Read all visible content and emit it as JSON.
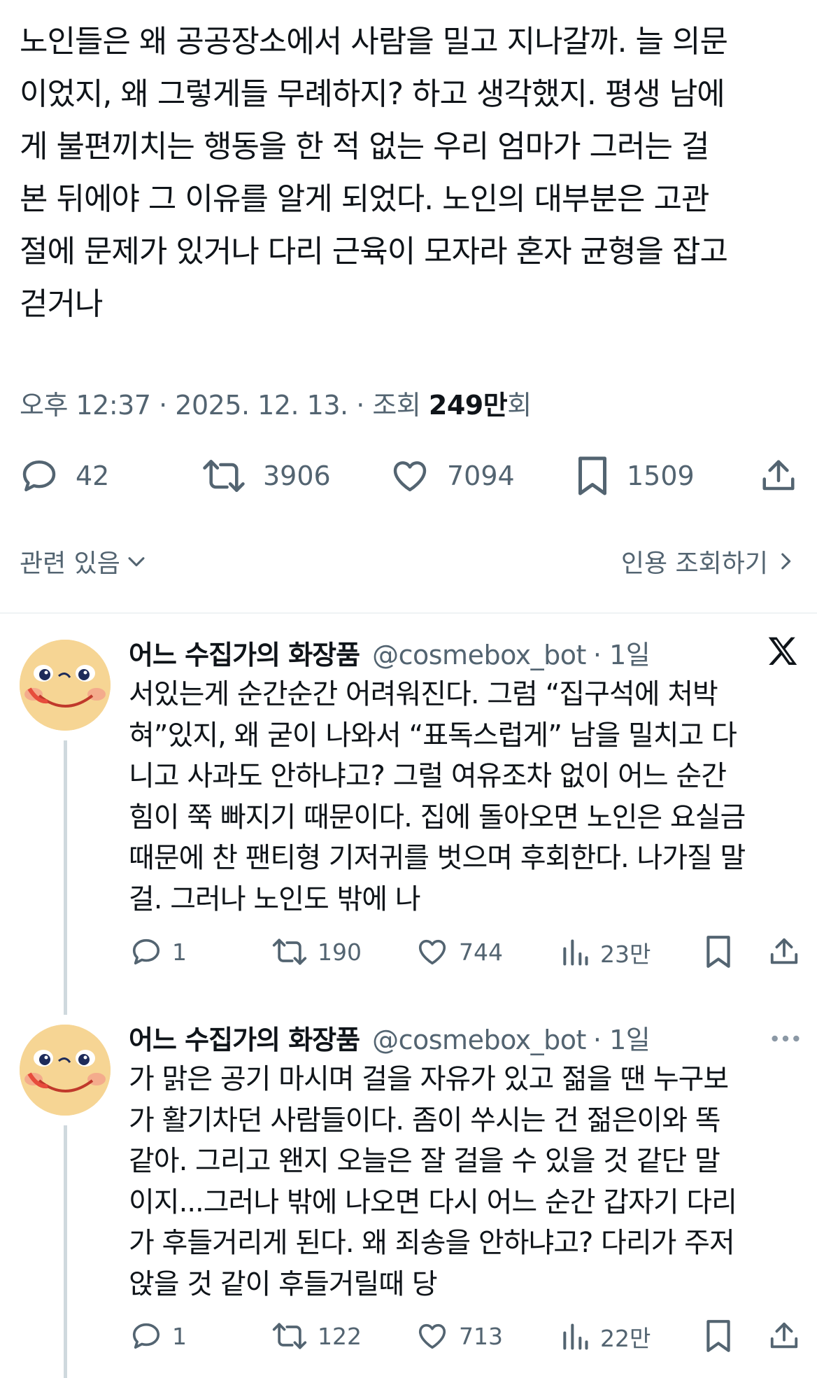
{
  "tweet": {
    "text": "노인들은 왜 공공장소에서 사람을 밀고 지나갈까. 늘 의문\n이었지, 왜 그렇게들 무례하지? 하고 생각했지. 평생 남에\n게 불편끼치는 행동을 한 적 없는 우리 엄마가 그러는 걸\n본 뒤에야 그 이유를 알게 되었다. 노인의 대부분은 고관\n절에 문제가 있거나 다리 근육이 모자라 혼자 균형을 잡고\n걷거나",
    "time": "오후 12:37",
    "date": "2025. 12. 13.",
    "views_label": "조회",
    "views_value": "249만",
    "views_suffix": "회",
    "separator": "·",
    "replies": "42",
    "retweets": "3906",
    "likes": "7094",
    "bookmarks": "1509"
  },
  "related": {
    "label": "관련 있음",
    "quote_label": "인용 조회하기"
  },
  "replies": [
    {
      "name": "어느 수집가의 화장품",
      "handle": "@cosmebox_bot",
      "time": "· 1일",
      "text": "서있는게 순간순간 어려워진다. 그럼 “집구석에 처박\n혀”있지, 왜 굳이 나와서 “표독스럽게” 남을 밀치고 다\n니고 사과도 안하냐고? 그럴 여유조차 없이 어느 순간\n힘이 쭉 빠지기 때문이다. 집에 돌아오면 노인은 요실금\n때문에 찬 팬티형 기저귀를 벗으며 후회한다. 나가질 말\n걸. 그러나 노인도 밖에 나",
      "replies": "1",
      "retweets": "190",
      "likes": "744",
      "views": "23만"
    },
    {
      "name": "어느 수집가의 화장품",
      "handle": "@cosmebox_bot",
      "time": "· 1일",
      "text": "가 맑은 공기 마시며 걸을 자유가 있고 젊을 땐 누구보\n가 활기차던 사람들이다. 좀이 쑤시는 건 젊은이와 똑\n같아. 그리고 왠지 오늘은 잘 걸을 수 있을 것 같단 말\n이지...그러나 밖에 나오면 다시 어느 순간 갑자기 다리\n가 후들거리게 된다. 왜 죄송을 안하냐고? 다리가 주저\n앉을 것 같이 후들거릴때 당",
      "replies": "1",
      "retweets": "122",
      "likes": "713",
      "views": "22만"
    }
  ],
  "colors": {
    "text": "#0f1419",
    "secondary": "#536471",
    "divider": "#eff3f4",
    "thread_line": "#cfd9de",
    "avatar": "#f6d594"
  }
}
